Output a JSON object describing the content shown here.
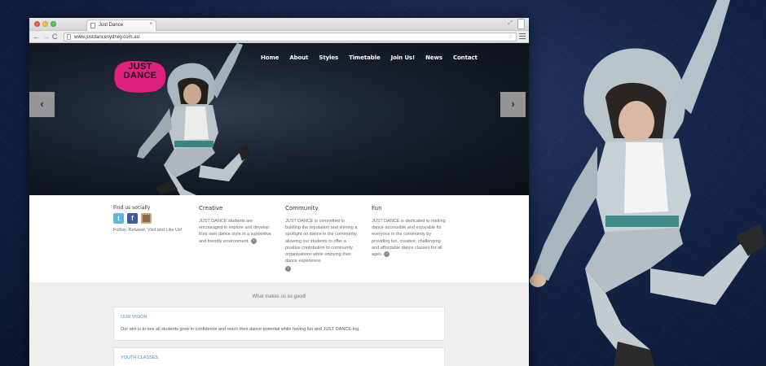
{
  "browser": {
    "tab_title": "Just Dance",
    "tab_close": "×",
    "url": "www.justdancesydney.com.au",
    "back": "←",
    "forward": "→",
    "reload": "C",
    "star": "☆",
    "resize": "⤢"
  },
  "site": {
    "logo_line1": "JUST",
    "logo_line2": "DANCE",
    "nav": [
      "Home",
      "About",
      "Styles",
      "Timetable",
      "Join Us!",
      "News",
      "Contact"
    ],
    "slider_prev": "‹",
    "slider_next": "›",
    "social": {
      "title": "Find us socially",
      "text": "Follow, Retweet, Visit and Like Us!",
      "icons": [
        "twitter-icon",
        "facebook-icon",
        "instagram-icon"
      ]
    },
    "features": [
      {
        "title": "Creative",
        "text": "JUST DANCE students are encouraged to explore and develop their own dance style in a supportive and friendly environment."
      },
      {
        "title": "Community",
        "text": "JUST DANCE is committed to building the reputation and shining a spotlight on dance in the community, allowing our students to offer a positive contribution to community organisations while enjoying their dance experience."
      },
      {
        "title": "Fun",
        "text": "JUST DANCE is dedicated to making dance accessible and enjoyable for everyone in the community by providing fun, creative, challenging and affordable dance classes for all ages."
      }
    ],
    "more_icon": "›",
    "section_heading": "What makes us so good!",
    "vision_title": "OUR VISION",
    "vision_text": "Our aim is to see all students grow in confidence and reach their dance potential while having fun and JUST DANCE-ing.",
    "youth_title": "YOUTH CLASSES"
  },
  "colors": {
    "accent_pink": "#e0227e",
    "link_blue": "#3b8dbf",
    "background_blue": "#142447"
  }
}
